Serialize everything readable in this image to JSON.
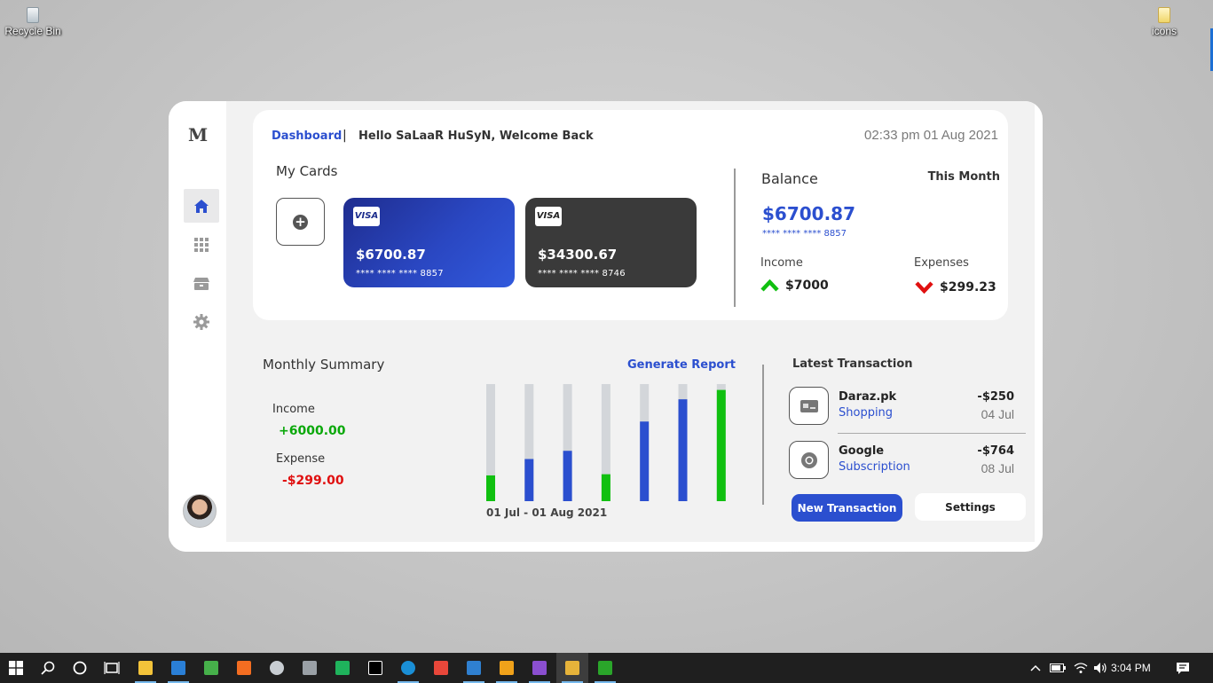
{
  "desktop": {
    "icons": [
      {
        "label": "Recycle Bin",
        "icon": "recycle-bin-icon"
      },
      {
        "label": "icons",
        "icon": "folder-icon"
      }
    ]
  },
  "app": {
    "logo": "M",
    "sidebar": {
      "items": [
        {
          "icon": "home-icon",
          "active": true
        },
        {
          "icon": "apps-grid-icon",
          "active": false
        },
        {
          "icon": "archive-icon",
          "active": false
        },
        {
          "icon": "gear-icon",
          "active": false
        }
      ]
    },
    "header": {
      "breadcrumb_active": "Dashboard",
      "separator": "|",
      "greeting": "Hello SaLaaR HuSyN, Welcome Back",
      "datetime": "02:33 pm 01 Aug 2021"
    },
    "my_cards": {
      "title": "My Cards",
      "cards": [
        {
          "brand": "VISA",
          "amount": "$6700.87",
          "masked": "**** **** **** 8857",
          "color": "#2a47c2"
        },
        {
          "brand": "VISA",
          "amount": "$34300.67",
          "masked": "**** **** **** 8746",
          "color": "#3a3a3a"
        }
      ]
    },
    "balance": {
      "title": "Balance",
      "period": "This Month",
      "amount": "$6700.87",
      "masked": "**** **** **** 8857",
      "income_label": "Income",
      "income_value": "$7000",
      "expenses_label": "Expenses",
      "expenses_value": "$299.23"
    },
    "monthly_summary": {
      "title": "Monthly Summary",
      "generate_report": "Generate Report",
      "income_label": "Income",
      "income_value": "+6000.00",
      "expense_label": "Expense",
      "expense_value": "-$299.00",
      "range": "01 Jul - 01 Aug 2021"
    },
    "latest_transaction": {
      "title": "Latest Transaction",
      "items": [
        {
          "name": "Daraz.pk",
          "category": "Shopping",
          "amount": "-$250",
          "date": "04 Jul",
          "icon": "credit-card-icon"
        },
        {
          "name": "Google",
          "category": "Subscription",
          "amount": "-$764",
          "date": "08 Jul",
          "icon": "chrome-icon"
        }
      ],
      "new_button": "New Transaction",
      "settings_button": "Settings"
    }
  },
  "chart_data": {
    "type": "bar",
    "title": "",
    "xlabel": "01 Jul - 01 Aug 2021",
    "ylabel": "",
    "ylim": [
      0,
      1
    ],
    "categories": [
      "1",
      "2",
      "3",
      "4",
      "5",
      "6",
      "7"
    ],
    "values": [
      0.22,
      0.36,
      0.43,
      0.23,
      0.68,
      0.87,
      0.95
    ],
    "colors": [
      "#10c010",
      "#2b4fcf",
      "#2b4fcf",
      "#10c010",
      "#2b4fcf",
      "#2b4fcf",
      "#10c010"
    ],
    "track_color": "#d3d6da",
    "grid": false
  },
  "taskbar": {
    "apps": [
      {
        "icon": "windows-start-icon"
      },
      {
        "icon": "search-icon"
      },
      {
        "icon": "cortana-icon"
      },
      {
        "icon": "task-view-icon"
      },
      {
        "icon": "file-explorer-icon",
        "color": "#f3c33a"
      },
      {
        "icon": "mail-icon",
        "color": "#2a7fd6"
      },
      {
        "icon": "paint-icon",
        "color": "#46b04a"
      },
      {
        "icon": "xampp-icon",
        "color": "#f36d21"
      },
      {
        "icon": "browser-icon",
        "color": "#c8cdd2"
      },
      {
        "icon": "database-icon",
        "color": "#9aa0a6"
      },
      {
        "icon": "sheets-icon",
        "color": "#1fb35c"
      },
      {
        "icon": "phpstorm-icon",
        "color": "#000000"
      },
      {
        "icon": "edge-icon",
        "color": "#1a8fd6"
      },
      {
        "icon": "app-c-icon",
        "color": "#e8473a"
      },
      {
        "icon": "photos-icon",
        "color": "#2f80d0"
      },
      {
        "icon": "compass-icon",
        "color": "#f0a21a"
      },
      {
        "icon": "visual-studio-icon",
        "color": "#8b4fd0"
      },
      {
        "icon": "figma-icon",
        "color": "#e6b33a"
      },
      {
        "icon": "code-editor-icon",
        "color": "#2aa52a"
      }
    ],
    "tray": [
      "chevron-up-icon",
      "battery-icon",
      "wifi-icon",
      "volume-icon"
    ],
    "clock": "3:04 PM",
    "notification_icon": "notification-icon"
  }
}
